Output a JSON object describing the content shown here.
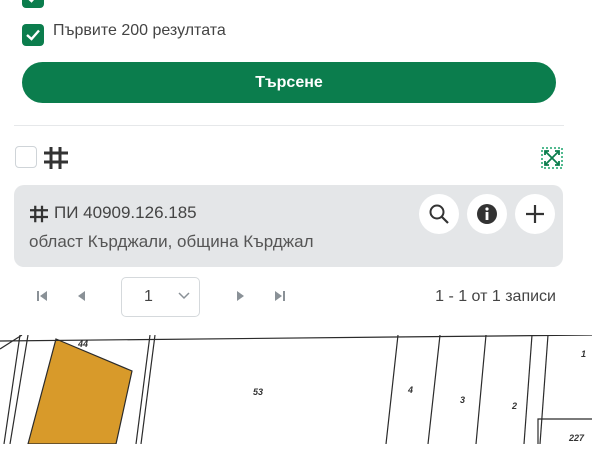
{
  "filters": {
    "first_200_label": "Първите 200 резултата"
  },
  "search": {
    "button_label": "Търсене"
  },
  "result": {
    "title": "ПИ 40909.126.185",
    "subtitle": "област Кърджали, община Кърджал"
  },
  "pager": {
    "current_page": "1",
    "records_text": "1 - 1 от 1 записи"
  },
  "map": {
    "labels": [
      "44",
      "53",
      "4",
      "3",
      "2",
      "1",
      "227"
    ],
    "highlight_color": "#d89a2a"
  },
  "colors": {
    "accent": "#0b7d4d",
    "card": "#e4e6e8"
  }
}
